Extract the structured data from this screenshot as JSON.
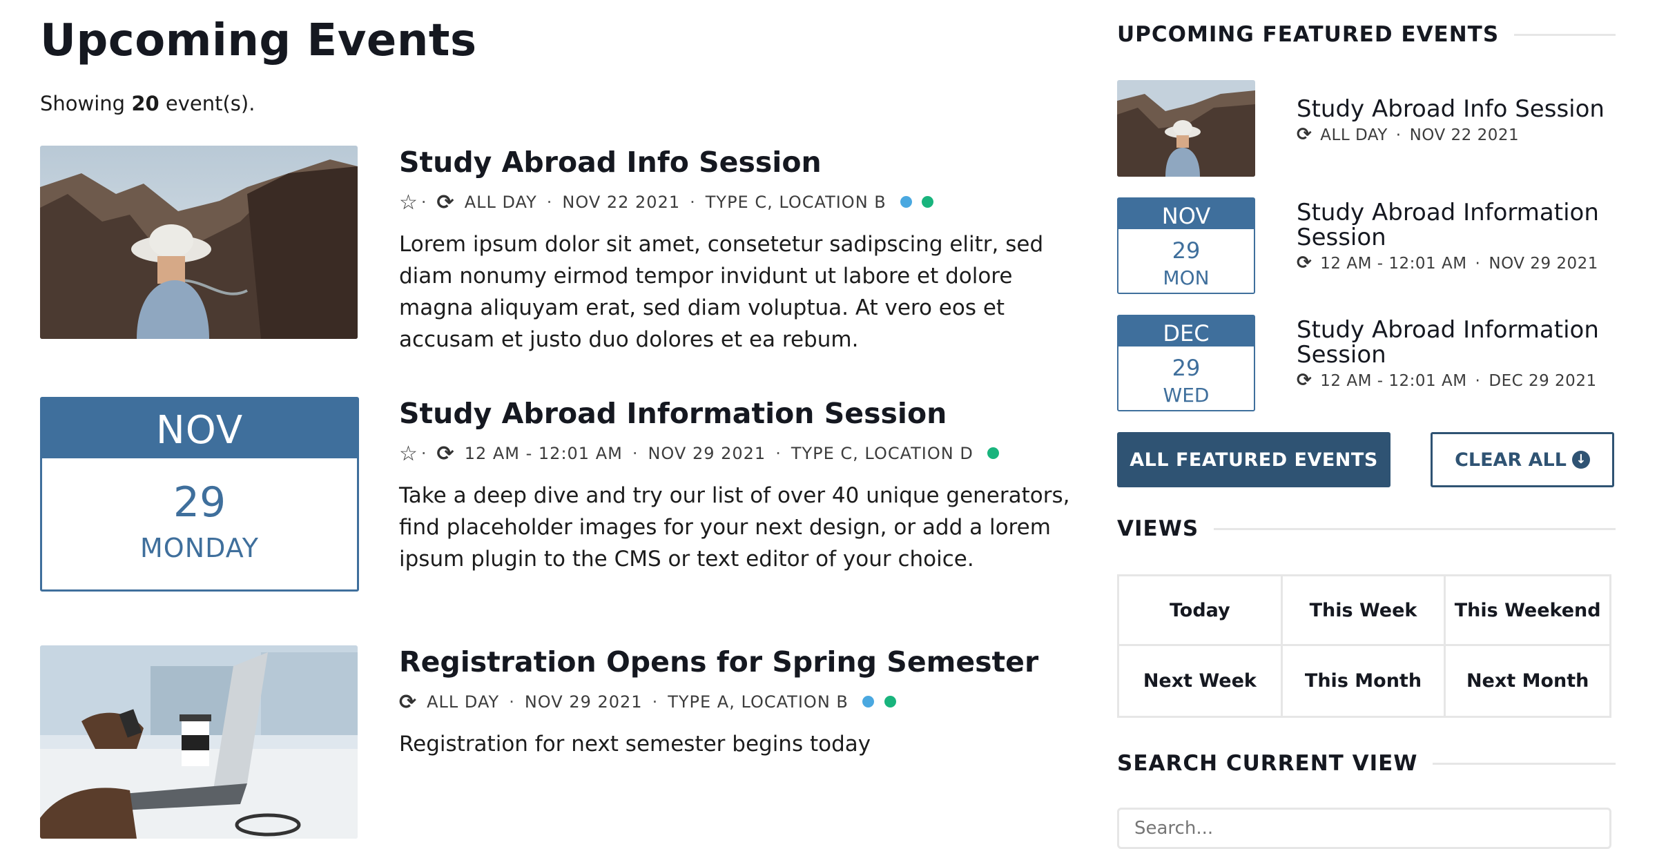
{
  "page": {
    "title": "Upcoming Events",
    "showing_prefix": "Showing ",
    "showing_count": "20",
    "showing_suffix": " event(s)."
  },
  "events": [
    {
      "title": "Study Abroad Info Session",
      "time": "ALL DAY",
      "date": "NOV 22 2021",
      "type_location": "TYPE C, LOCATION B",
      "star": true,
      "dots": [
        "#4aa8e0",
        "#19b47d"
      ],
      "thumbnail": "photo-hiker-canyon",
      "description": "Lorem ipsum dolor sit amet, consetetur sadipscing elitr, sed diam nonumy eirmod tempor invidunt ut labore et dolore magna aliquyam erat, sed diam voluptua. At vero eos et accusam et justo duo dolores et ea rebum."
    },
    {
      "title": "Study Abroad Information Session",
      "time": "12 AM - 12:01 AM",
      "date": "NOV 29 2021",
      "type_location": "TYPE C, LOCATION D",
      "star": true,
      "dots": [
        "#19b47d"
      ],
      "date_badge": {
        "month": "NOV",
        "day": "29",
        "weekday": "MONDAY"
      },
      "description": "Take a deep dive and try our list of over 40 unique generators, find placeholder images for your next design, or add a lorem ipsum plugin to the CMS or text editor of your choice."
    },
    {
      "title": "Registration Opens for Spring Semester",
      "time": "ALL DAY",
      "date": "NOV 29 2021",
      "type_location": "TYPE A, LOCATION B",
      "star": false,
      "dots": [
        "#4aa8e0",
        "#19b47d"
      ],
      "thumbnail": "photo-laptop-coffee",
      "description": "Registration for next semester begins today"
    }
  ],
  "sidebar": {
    "featured_heading": "UPCOMING FEATURED EVENTS",
    "featured": [
      {
        "title": "Study Abroad Info Session",
        "time": "ALL DAY",
        "date": "NOV 22 2021",
        "thumbnail": "photo-hiker-canyon"
      },
      {
        "title": "Study Abroad Information Session",
        "time": "12 AM - 12:01 AM",
        "date": "NOV 29 2021",
        "badge": {
          "month": "NOV",
          "day": "29",
          "weekday": "MON"
        }
      },
      {
        "title": "Study Abroad Information Session",
        "time": "12 AM - 12:01 AM",
        "date": "DEC 29 2021",
        "badge": {
          "month": "DEC",
          "day": "29",
          "weekday": "WED"
        }
      }
    ],
    "all_featured_label": "ALL FEATURED EVENTS",
    "clear_all_label": "CLEAR ALL",
    "views_heading": "VIEWS",
    "views": [
      "Today",
      "This Week",
      "This Weekend",
      "Next Week",
      "This Month",
      "Next Month"
    ],
    "search_heading": "SEARCH CURRENT VIEW",
    "search_placeholder": "Search..."
  },
  "colors": {
    "accent": "#3f6f9c",
    "button_dark": "#2f5373",
    "dot_blue": "#4aa8e0",
    "dot_green": "#19b47d"
  },
  "icons": {
    "star": "star-outline-icon",
    "repeat": "repeat-icon",
    "clear": "arrow-down-circle-icon"
  }
}
